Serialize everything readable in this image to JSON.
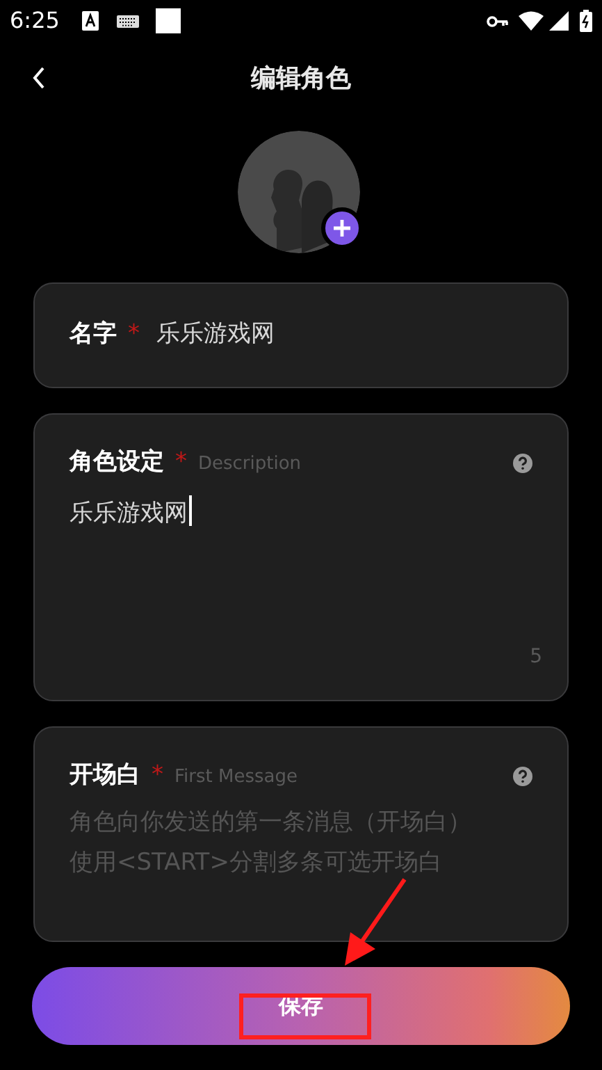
{
  "status_bar": {
    "time": "6:25"
  },
  "header": {
    "title": "编辑角色"
  },
  "fields": [
    {
      "kind": "single",
      "label": "名字",
      "required_mark": "*",
      "value": "乐乐游戏网"
    },
    {
      "kind": "multi",
      "label": "角色设定",
      "required_mark": "*",
      "hint": "Description",
      "value": "乐乐游戏网",
      "counter": "5",
      "focused": true
    },
    {
      "kind": "multi",
      "label": "开场白",
      "required_mark": "*",
      "hint": "First Message",
      "placeholder_lines": [
        "角色向你发送的第一条消息（开场白）",
        "使用<START>分割多条可选开场白"
      ]
    }
  ],
  "save_button": {
    "label": "保存"
  }
}
